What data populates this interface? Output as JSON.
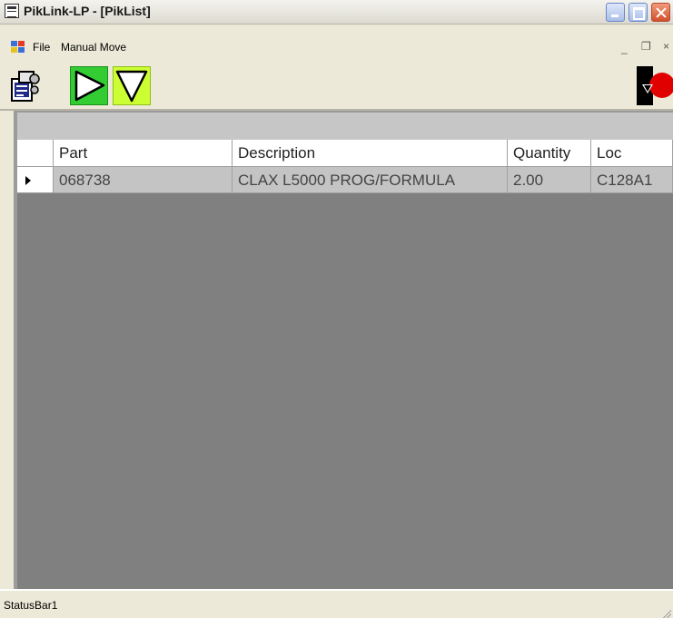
{
  "window": {
    "title": "PikLink-LP - [PikList]"
  },
  "menu": {
    "items": [
      "File",
      "Manual Move"
    ],
    "mdi_controls": [
      "_",
      "͆",
      "×"
    ]
  },
  "toolbar": {
    "buttons": [
      {
        "icon": "document-gears-icon"
      },
      {
        "icon": "play-forward-icon",
        "color": "#33cc33"
      },
      {
        "icon": "filter-down-icon",
        "color": "#ccff33"
      },
      {
        "icon": "stop-pointer-icon",
        "color": "#e00000"
      }
    ]
  },
  "grid": {
    "columns": [
      "Part",
      "Description",
      "Quantity",
      "Loc"
    ],
    "rows": [
      [
        "068738",
        "CLAX L5000 PROG/FORMULA",
        "2.00",
        "C128A1"
      ]
    ]
  },
  "status": {
    "text": "StatusBar1"
  },
  "colors": {
    "grid_background": "#808080",
    "selected_row": "#c4c4c4",
    "chrome": "#ece9d8"
  }
}
